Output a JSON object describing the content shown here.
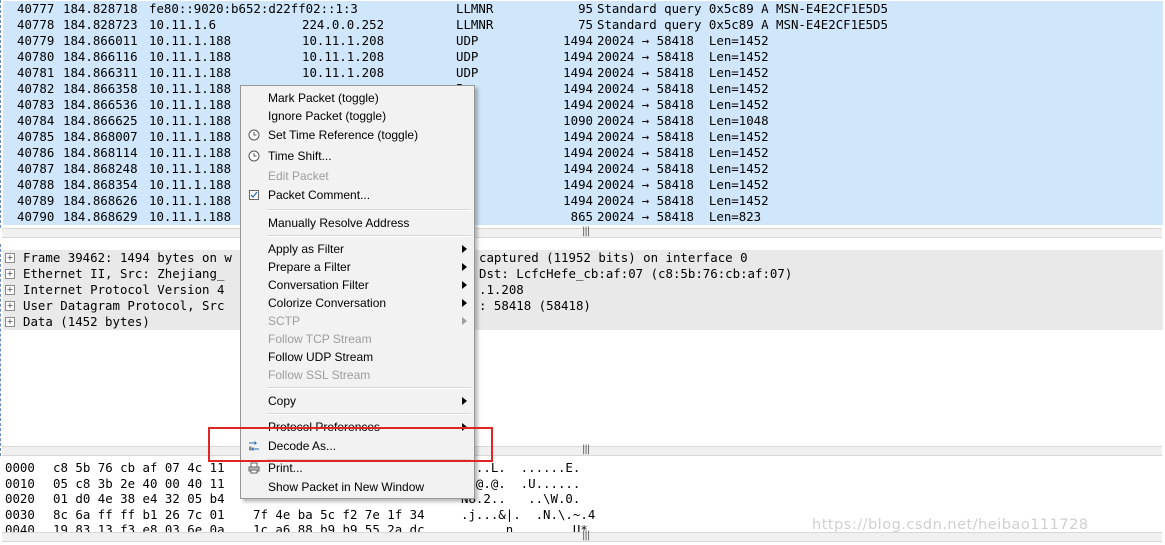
{
  "packets": [
    {
      "no": "40777",
      "time": "184.828718",
      "src": "fe80::9020:b652:d22ff02::1:3",
      "dst": "",
      "proto": "LLMNR",
      "len": "95",
      "info": "Standard query 0x5c89 A MSN-E4E2CF1E5D5"
    },
    {
      "no": "40778",
      "time": "184.828723",
      "src": "10.11.1.6",
      "dst": "224.0.0.252",
      "proto": "LLMNR",
      "len": "75",
      "info": "Standard query 0x5c89 A MSN-E4E2CF1E5D5"
    },
    {
      "no": "40779",
      "time": "184.866011",
      "src": "10.11.1.188",
      "dst": "10.11.1.208",
      "proto": "UDP",
      "len": "1494",
      "info": "20024 → 58418  Len=1452"
    },
    {
      "no": "40780",
      "time": "184.866116",
      "src": "10.11.1.188",
      "dst": "10.11.1.208",
      "proto": "UDP",
      "len": "1494",
      "info": "20024 → 58418  Len=1452"
    },
    {
      "no": "40781",
      "time": "184.866311",
      "src": "10.11.1.188",
      "dst": "10.11.1.208",
      "proto": "UDP",
      "len": "1494",
      "info": "20024 → 58418  Len=1452"
    },
    {
      "no": "40782",
      "time": "184.866358",
      "src": "10.11.1.188",
      "dst": "",
      "proto": "P",
      "len": "1494",
      "info": "20024 → 58418  Len=1452"
    },
    {
      "no": "40783",
      "time": "184.866536",
      "src": "10.11.1.188",
      "dst": "",
      "proto": "P",
      "len": "1494",
      "info": "20024 → 58418  Len=1452"
    },
    {
      "no": "40784",
      "time": "184.866625",
      "src": "10.11.1.188",
      "dst": "",
      "proto": "P",
      "len": "1090",
      "info": "20024 → 58418  Len=1048"
    },
    {
      "no": "40785",
      "time": "184.868007",
      "src": "10.11.1.188",
      "dst": "",
      "proto": "P",
      "len": "1494",
      "info": "20024 → 58418  Len=1452"
    },
    {
      "no": "40786",
      "time": "184.868114",
      "src": "10.11.1.188",
      "dst": "",
      "proto": "P",
      "len": "1494",
      "info": "20024 → 58418  Len=1452"
    },
    {
      "no": "40787",
      "time": "184.868248",
      "src": "10.11.1.188",
      "dst": "",
      "proto": "P",
      "len": "1494",
      "info": "20024 → 58418  Len=1452"
    },
    {
      "no": "40788",
      "time": "184.868354",
      "src": "10.11.1.188",
      "dst": "",
      "proto": "P",
      "len": "1494",
      "info": "20024 → 58418  Len=1452"
    },
    {
      "no": "40789",
      "time": "184.868626",
      "src": "10.11.1.188",
      "dst": "",
      "proto": "P",
      "len": "1494",
      "info": "20024 → 58418  Len=1452"
    },
    {
      "no": "40790",
      "time": "184.868629",
      "src": "10.11.1.188",
      "dst": "",
      "proto": "P",
      "len": "865",
      "info": "20024 → 58418  Len=823"
    }
  ],
  "details": [
    {
      "left": "Frame 39462: 1494 bytes on w",
      "right": "captured (11952 bits) on interface 0"
    },
    {
      "left": "Ethernet II, Src: Zhejiang_",
      "right": "Dst: LcfcHefe_cb:af:07 (c8:5b:76:cb:af:07)"
    },
    {
      "left": "Internet Protocol Version 4",
      "right": ".1.208"
    },
    {
      "left": "User Datagram Protocol, Src",
      "right": ": 58418 (58418)"
    },
    {
      "left": "Data (1452 bytes)",
      "right": ""
    }
  ],
  "bytes": [
    {
      "offset": "0000",
      "hex1": "c8 5b 76 cb af 07 4c 11",
      "hex2": "",
      "ascii": "V...L.  ......E."
    },
    {
      "offset": "0010",
      "hex1": "05 c8 3b 2e 40 00 40 11",
      "hex2": "",
      "ascii": ";.@.@.  .U......"
    },
    {
      "offset": "0020",
      "hex1": "01 d0 4e 38 e4 32 05 b4",
      "hex2": "",
      "ascii": "N8.2..   ..\\W.0."
    },
    {
      "offset": "0030",
      "hex1": "8c 6a ff ff b1 26 7c 01",
      "hex2": "7f 4e ba 5c f2 7e 1f 34",
      "ascii": ".j...&|.  .N.\\.~.4"
    },
    {
      "offset": "0040",
      "hex1": "19 83 13 f3 e8 03 6e 0a",
      "hex2": "1c a6 88 b9 b9 55 2a dc",
      "ascii": "......n.  .....U*."
    }
  ],
  "watermark": "https://blog.csdn.net/heibao111728",
  "menu": {
    "mark_packet": "Mark Packet (toggle)",
    "ignore_packet": "Ignore Packet (toggle)",
    "set_time_ref": "Set Time Reference (toggle)",
    "time_shift": "Time Shift...",
    "edit_packet": "Edit Packet",
    "packet_comment": "Packet Comment...",
    "resolve_address": "Manually Resolve Address",
    "apply_filter": "Apply as Filter",
    "prepare_filter": "Prepare a Filter",
    "conversation_filter": "Conversation Filter",
    "colorize_conversation": "Colorize Conversation",
    "sctp": "SCTP",
    "follow_tcp": "Follow TCP Stream",
    "follow_udp": "Follow UDP Stream",
    "follow_ssl": "Follow SSL Stream",
    "copy": "Copy",
    "protocol_prefs": "Protocol Preferences",
    "decode_as": "Decode As...",
    "print": "Print...",
    "show_new_window": "Show Packet in New Window"
  },
  "colors": {
    "row_bg": "#cfe6fb",
    "detail_bg": "#e9e9e9",
    "highlight": "#e02525"
  }
}
